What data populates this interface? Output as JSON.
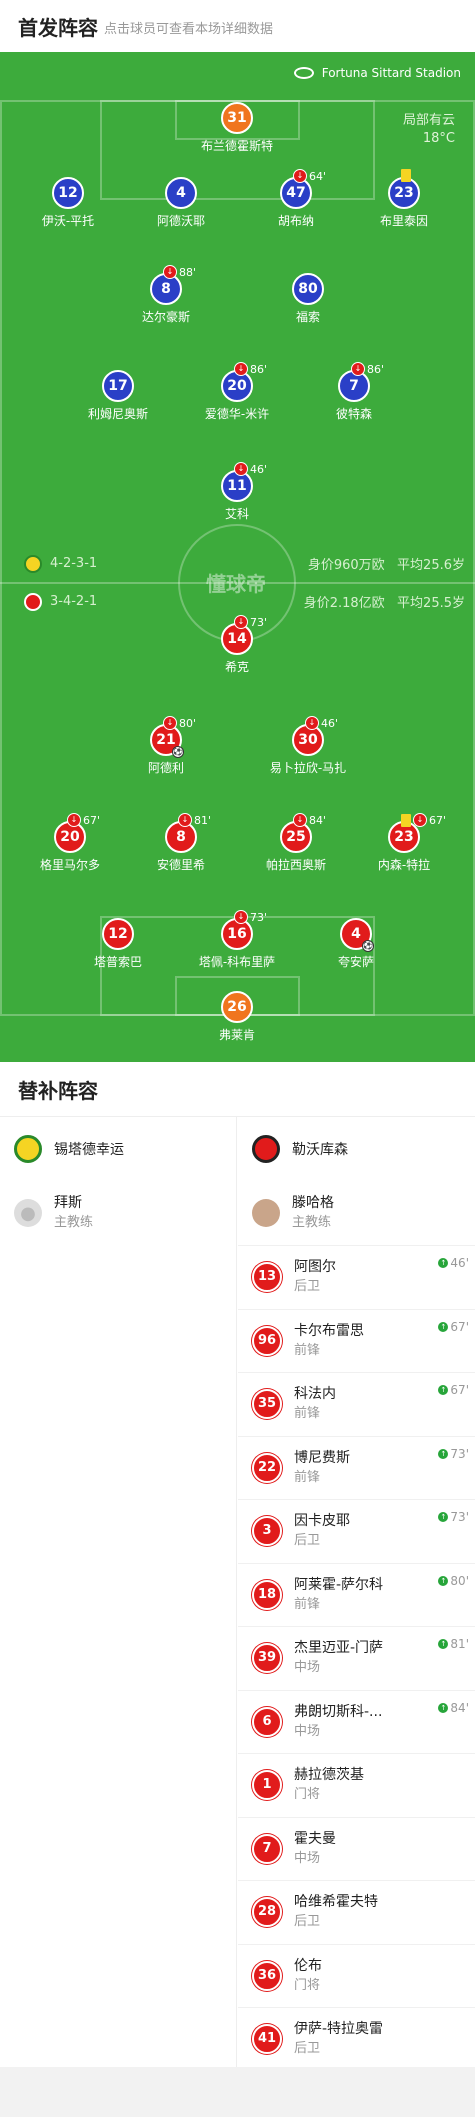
{
  "header": {
    "title": "首发阵容",
    "subtitle": "点击球员可查看本场详细数据"
  },
  "venue": {
    "name": "Fortuna Sittard Stadion",
    "weather": "局部有云",
    "temperature": "18°C"
  },
  "watermark": "懂球帝",
  "home": {
    "formation": "4-2-3-1",
    "value": "身价960万欧",
    "age": "平均25.6岁",
    "color": "#2a3fc7"
  },
  "away": {
    "formation": "3-4-2-1",
    "value": "身价2.18亿欧",
    "age": "平均25.5岁",
    "color": "#e11b1b"
  },
  "pitch_players": [
    {
      "num": "31",
      "name": "布兰德霍斯特",
      "team": "orange"
    },
    {
      "num": "12",
      "name": "伊沃-平托",
      "team": "blue"
    },
    {
      "num": "4",
      "name": "阿德沃耶",
      "team": "blue"
    },
    {
      "num": "47",
      "name": "胡布纳",
      "team": "blue",
      "sub": "64'"
    },
    {
      "num": "23",
      "name": "布里泰因",
      "team": "blue",
      "yellow": true
    },
    {
      "num": "8",
      "name": "达尔豪斯",
      "team": "blue",
      "sub": "88'"
    },
    {
      "num": "80",
      "name": "福索",
      "team": "blue"
    },
    {
      "num": "17",
      "name": "利姆尼奥斯",
      "team": "blue"
    },
    {
      "num": "20",
      "name": "爱德华-米许",
      "team": "blue",
      "sub": "86'"
    },
    {
      "num": "7",
      "name": "彼特森",
      "team": "blue",
      "sub": "86'"
    },
    {
      "num": "11",
      "name": "艾科",
      "team": "blue",
      "sub": "46'"
    },
    {
      "num": "14",
      "name": "希克",
      "team": "red",
      "sub": "73'"
    },
    {
      "num": "21",
      "name": "阿德利",
      "team": "red",
      "sub": "80'",
      "goal": true
    },
    {
      "num": "30",
      "name": "易卜拉欣-马扎",
      "team": "red",
      "sub": "46'"
    },
    {
      "num": "20",
      "name": "格里马尔多",
      "team": "red",
      "sub": "67'"
    },
    {
      "num": "8",
      "name": "安德里希",
      "team": "red",
      "sub": "81'"
    },
    {
      "num": "25",
      "name": "帕拉西奥斯",
      "team": "red",
      "sub": "84'"
    },
    {
      "num": "23",
      "name": "内森-特拉",
      "team": "red",
      "sub": "67'",
      "yellow": true
    },
    {
      "num": "12",
      "name": "塔普索巴",
      "team": "red"
    },
    {
      "num": "16",
      "name": "塔佩-科布里萨",
      "team": "red",
      "sub": "73'"
    },
    {
      "num": "4",
      "name": "夸安萨",
      "team": "red",
      "goal": true
    },
    {
      "num": "26",
      "name": "弗莱肯",
      "team": "orange"
    }
  ],
  "subs": {
    "title": "替补阵容",
    "home_team": "锡塔德幸运",
    "away_team": "勒沃库森",
    "home_coach": {
      "name": "拜斯",
      "role": "主教练"
    },
    "away_coach": {
      "name": "滕哈格",
      "role": "主教练"
    },
    "away_list": [
      {
        "num": "13",
        "name": "阿图尔",
        "pos": "后卫",
        "in": "46'"
      },
      {
        "num": "96",
        "name": "卡尔布雷思",
        "pos": "前锋",
        "in": "67'"
      },
      {
        "num": "35",
        "name": "科法内",
        "pos": "前锋",
        "in": "67'"
      },
      {
        "num": "22",
        "name": "博尼费斯",
        "pos": "前锋",
        "in": "73'"
      },
      {
        "num": "3",
        "name": "因卡皮耶",
        "pos": "后卫",
        "in": "73'"
      },
      {
        "num": "18",
        "name": "阿莱霍-萨尔科",
        "pos": "前锋",
        "in": "80'"
      },
      {
        "num": "39",
        "name": "杰里迈亚-门萨",
        "pos": "中场",
        "in": "81'"
      },
      {
        "num": "6",
        "name": "弗朗切斯科-...",
        "pos": "中场",
        "in": "84'"
      },
      {
        "num": "1",
        "name": "赫拉德茨基",
        "pos": "门将"
      },
      {
        "num": "7",
        "name": "霍夫曼",
        "pos": "中场"
      },
      {
        "num": "28",
        "name": "哈维希霍夫特",
        "pos": "后卫"
      },
      {
        "num": "36",
        "name": "伦布",
        "pos": "门将"
      },
      {
        "num": "41",
        "name": "伊萨-特拉奥雷",
        "pos": "后卫"
      }
    ]
  }
}
